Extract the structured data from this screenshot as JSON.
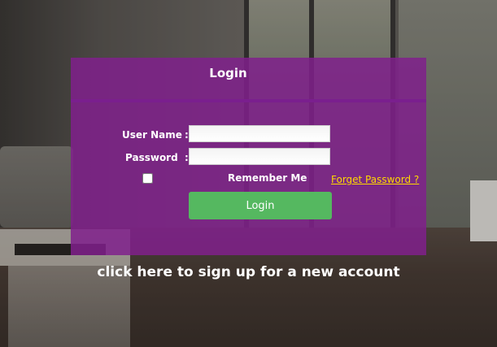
{
  "login": {
    "title": "Login",
    "username_label": "User Name",
    "password_label": "Password",
    "colon": ":",
    "username_value": "",
    "password_value": "",
    "remember_label": "Remember Me",
    "remember_checked": false,
    "forget_link": "Forget Password ?",
    "login_button": "Login"
  },
  "signup_link": "click here to sign up for a new account",
  "colors": {
    "panel": "#80208c",
    "button": "#55b860",
    "link": "#ffd800"
  }
}
